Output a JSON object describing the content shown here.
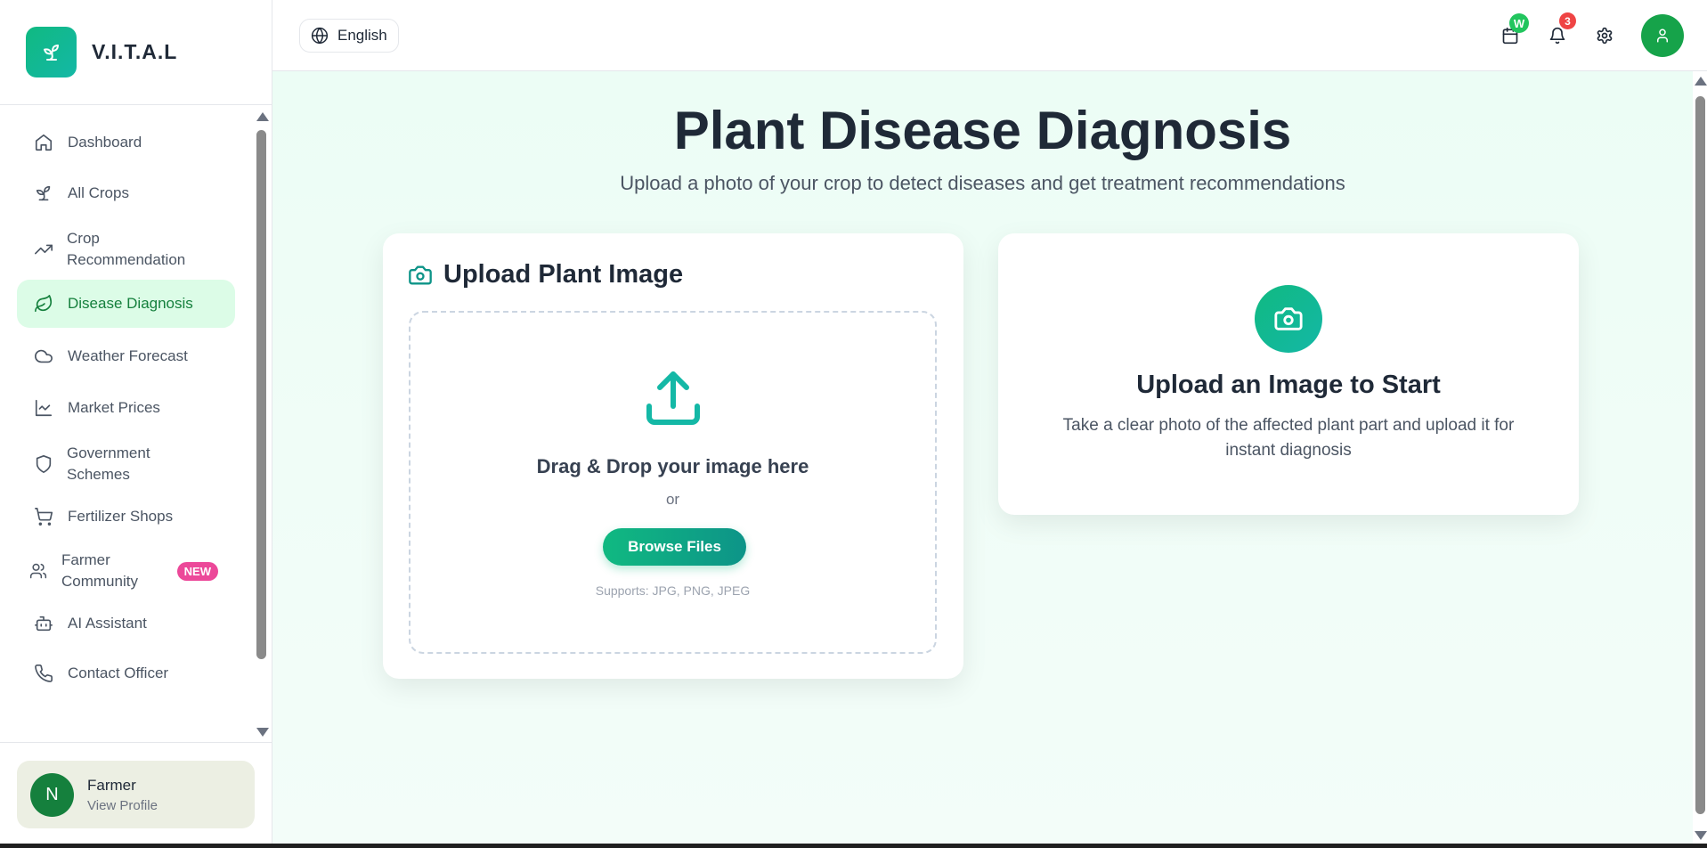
{
  "brand": {
    "name": "V.I.T.A.L"
  },
  "sidebar": {
    "items": [
      {
        "label": "Dashboard",
        "icon": "home-icon"
      },
      {
        "label": "All Crops",
        "icon": "sprout-icon"
      },
      {
        "label": "Crop\nRecommendation",
        "icon": "trending-up-icon"
      },
      {
        "label": "Disease Diagnosis",
        "icon": "leaf-icon",
        "active": true
      },
      {
        "label": "Weather Forecast",
        "icon": "cloud-icon"
      },
      {
        "label": "Market Prices",
        "icon": "line-chart-icon"
      },
      {
        "label": "Government\nSchemes",
        "icon": "shield-icon"
      },
      {
        "label": "Fertilizer Shops",
        "icon": "cart-icon"
      },
      {
        "label": "Farmer\nCommunity",
        "icon": "users-icon",
        "badge": "NEW"
      },
      {
        "label": "AI Assistant",
        "icon": "bot-icon"
      },
      {
        "label": "Contact Officer",
        "icon": "phone-icon"
      }
    ],
    "profile": {
      "initial": "N",
      "name": "Farmer",
      "sub": "View Profile"
    }
  },
  "header": {
    "language": "English",
    "calendar_badge": "W",
    "notifications_count": "3"
  },
  "main": {
    "title": "Plant Disease Diagnosis",
    "subtitle": "Upload a photo of your crop to detect diseases and get treatment recommendations",
    "upload": {
      "title": "Upload Plant Image",
      "drop_title": "Drag & Drop your image here",
      "or": "or",
      "browse": "Browse Files",
      "supports": "Supports: JPG, PNG, JPEG"
    },
    "info": {
      "title": "Upload an Image to Start",
      "desc": "Take a clear photo of the affected plant part and upload it for instant diagnosis"
    }
  },
  "colors": {
    "accent": "#10b981",
    "active_bg": "#dcfce7",
    "active_text": "#15803d",
    "badge_pink": "#ec4899",
    "notify_red": "#ef4444"
  }
}
